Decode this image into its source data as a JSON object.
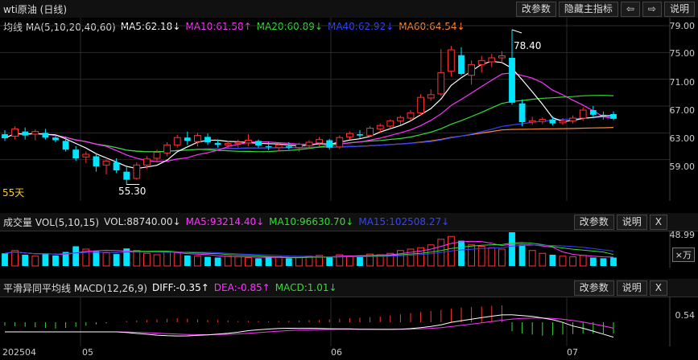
{
  "header": {
    "title": "wti原油 (日线)",
    "buttons": [
      "改参数",
      "隐藏主指标",
      "⇦",
      "⇨",
      "说明"
    ]
  },
  "main_panel": {
    "indicator_name": "均线 MA(5,10,20,40,60)",
    "ma_values": [
      {
        "label": "MA5:62.18↓",
        "color": "#ffffff"
      },
      {
        "label": "MA10:61.58↑",
        "color": "#ff33ff"
      },
      {
        "label": "MA20:60.89↓",
        "color": "#33dd33"
      },
      {
        "label": "MA40:62.92↓",
        "color": "#3344ff"
      },
      {
        "label": "MA60:64.54↓",
        "color": "#ff8833"
      }
    ],
    "y_ticks": [
      "79.00",
      "75.00",
      "71.00",
      "67.00",
      "63.00",
      "59.00"
    ],
    "high_label": "78.40",
    "low_label": "55.30",
    "period_label": "55天"
  },
  "volume_panel": {
    "indicator_name": "成交量 VOL(5,10,15)",
    "vol_label": "VOL:88740.00↓",
    "ma_values": [
      {
        "label": "MA5:93214.40↓",
        "color": "#ff33ff"
      },
      {
        "label": "MA10:96630.70↓",
        "color": "#33dd33"
      },
      {
        "label": "MA15:102508.27↓",
        "color": "#3344ff"
      }
    ],
    "buttons": [
      "改参数",
      "说明",
      "X"
    ],
    "y_tick": "48.99",
    "unit": "×万"
  },
  "macd_panel": {
    "indicator_name": "平滑异同平均线 MACD(12,26,9)",
    "values": [
      {
        "label": "DIFF:-0.35↑",
        "color": "#ffffff"
      },
      {
        "label": "DEA:-0.85↑",
        "color": "#ff33ff"
      },
      {
        "label": "MACD:1.01↓",
        "color": "#33dd33"
      }
    ],
    "buttons": [
      "改参数",
      "说明",
      "X"
    ],
    "y_tick": "0.54"
  },
  "x_axis": [
    "202504",
    "05",
    "06",
    "07"
  ],
  "chart_data": {
    "type": "candlestick",
    "candles": [
      [
        62.8,
        63.4,
        61.8,
        62.2
      ],
      [
        62.5,
        64.0,
        62.0,
        63.6
      ],
      [
        63.2,
        63.8,
        62.0,
        62.6
      ],
      [
        62.8,
        63.5,
        61.9,
        63.2
      ],
      [
        63.0,
        63.6,
        62.0,
        62.3
      ],
      [
        62.3,
        62.8,
        61.6,
        61.9
      ],
      [
        61.8,
        62.4,
        60.2,
        60.5
      ],
      [
        60.5,
        61.0,
        58.8,
        59.2
      ],
      [
        59.4,
        60.2,
        58.5,
        59.8
      ],
      [
        59.5,
        60.0,
        57.2,
        58.0
      ],
      [
        58.2,
        59.0,
        56.8,
        58.8
      ],
      [
        58.6,
        59.2,
        57.0,
        57.4
      ],
      [
        57.2,
        58.0,
        55.3,
        56.0
      ],
      [
        56.2,
        58.6,
        56.0,
        58.2
      ],
      [
        58.2,
        59.5,
        57.6,
        59.1
      ],
      [
        59.2,
        60.5,
        58.6,
        60.1
      ],
      [
        60.0,
        61.6,
        59.5,
        61.2
      ],
      [
        61.2,
        62.7,
        60.8,
        62.3
      ],
      [
        62.3,
        63.2,
        61.2,
        61.8
      ],
      [
        61.7,
        63.0,
        61.0,
        62.6
      ],
      [
        62.4,
        62.9,
        61.2,
        61.6
      ],
      [
        61.5,
        62.0,
        60.8,
        61.2
      ],
      [
        61.2,
        61.8,
        60.6,
        61.4
      ],
      [
        61.4,
        62.0,
        60.8,
        61.6
      ],
      [
        61.5,
        62.8,
        61.0,
        61.9
      ],
      [
        61.8,
        62.0,
        60.8,
        61.1
      ],
      [
        61.0,
        61.7,
        60.4,
        60.9
      ],
      [
        60.8,
        61.4,
        60.2,
        61.2
      ],
      [
        61.0,
        61.6,
        60.5,
        60.8
      ],
      [
        60.8,
        61.5,
        60.2,
        61.3
      ],
      [
        61.1,
        61.9,
        60.6,
        61.6
      ],
      [
        61.5,
        62.4,
        61.0,
        62.0
      ],
      [
        61.9,
        62.1,
        60.5,
        60.8
      ],
      [
        60.9,
        62.6,
        60.6,
        62.3
      ],
      [
        62.4,
        63.2,
        62.0,
        62.9
      ],
      [
        62.8,
        63.4,
        62.2,
        62.6
      ],
      [
        62.6,
        64.0,
        62.4,
        63.7
      ],
      [
        63.6,
        64.4,
        63.0,
        64.1
      ],
      [
        64.0,
        65.0,
        63.6,
        64.8
      ],
      [
        64.8,
        65.6,
        64.2,
        65.3
      ],
      [
        65.2,
        66.4,
        64.8,
        66.0
      ],
      [
        66.0,
        68.8,
        65.6,
        68.3
      ],
      [
        68.2,
        69.5,
        67.8,
        68.7
      ],
      [
        68.8,
        75.5,
        68.5,
        72.0
      ],
      [
        72.2,
        76.0,
        71.4,
        75.4
      ],
      [
        74.6,
        75.8,
        71.6,
        71.8
      ],
      [
        71.6,
        73.8,
        70.2,
        73.2
      ],
      [
        73.2,
        74.5,
        72.0,
        73.8
      ],
      [
        73.6,
        74.8,
        72.8,
        74.2
      ],
      [
        74.2,
        75.2,
        73.5,
        74.5
      ],
      [
        74.2,
        78.4,
        67.2,
        67.5
      ],
      [
        67.4,
        68.0,
        64.0,
        64.6
      ],
      [
        64.6,
        65.4,
        64.2,
        64.8
      ],
      [
        64.7,
        65.3,
        64.3,
        65.0
      ],
      [
        65.0,
        65.5,
        64.1,
        64.4
      ],
      [
        64.5,
        65.2,
        64.2,
        64.8
      ],
      [
        64.8,
        65.6,
        64.4,
        65.2
      ],
      [
        65.2,
        66.8,
        64.8,
        66.4
      ],
      [
        66.4,
        67.0,
        65.4,
        65.7
      ],
      [
        65.7,
        66.2,
        65.0,
        65.6
      ],
      [
        65.8,
        66.2,
        64.9,
        65.1
      ]
    ],
    "volume": [
      18,
      22,
      16,
      14,
      17,
      15,
      20,
      28,
      24,
      21,
      19,
      17,
      25,
      22,
      18,
      16,
      20,
      19,
      15,
      14,
      13,
      12,
      14,
      13,
      12,
      11,
      12,
      13,
      11,
      12,
      14,
      15,
      13,
      16,
      14,
      15,
      17,
      16,
      18,
      22,
      24,
      26,
      30,
      38,
      42,
      36,
      30,
      28,
      26,
      24,
      48,
      30,
      22,
      18,
      16,
      14,
      13,
      15,
      12,
      11,
      12
    ],
    "macd_hist": [
      -0.3,
      -0.35,
      -0.4,
      -0.45,
      -0.5,
      -0.55,
      -0.5,
      -0.4,
      -0.3,
      -0.2,
      -0.1,
      0.0,
      0.1,
      0.15,
      0.2,
      0.25,
      0.3,
      0.35,
      0.3,
      0.25,
      0.2,
      0.2,
      0.15,
      0.1,
      0.12,
      0.1,
      0.08,
      0.1,
      0.12,
      0.15,
      0.18,
      0.2,
      0.25,
      0.3,
      0.35,
      0.4,
      0.45,
      0.5,
      0.6,
      0.7,
      0.8,
      0.9,
      1.0,
      1.1,
      1.2,
      1.3,
      1.35,
      1.4,
      1.45,
      1.5,
      -0.8,
      -1.0,
      -1.1,
      -1.2,
      -1.15,
      -1.1,
      -1.05,
      -1.0,
      -1.0,
      -1.0,
      -1.01
    ]
  }
}
